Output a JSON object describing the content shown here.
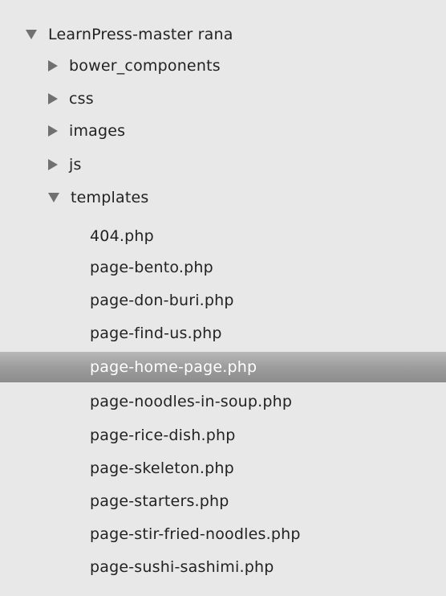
{
  "tree": {
    "root": {
      "label": "LearnPress-master rana",
      "expanded": true,
      "arrow_icon": "triangle-down-icon"
    },
    "folders": [
      {
        "label": "bower_components",
        "expanded": false,
        "arrow_icon": "triangle-right-icon"
      },
      {
        "label": "css",
        "expanded": false,
        "arrow_icon": "triangle-right-icon"
      },
      {
        "label": "images",
        "expanded": false,
        "arrow_icon": "triangle-right-icon"
      },
      {
        "label": "js",
        "expanded": false,
        "arrow_icon": "triangle-right-icon"
      },
      {
        "label": "templates",
        "expanded": true,
        "arrow_icon": "triangle-down-icon"
      }
    ],
    "files": [
      {
        "label": "404.php"
      },
      {
        "label": "page-bento.php"
      },
      {
        "label": "page-don-buri.php"
      },
      {
        "label": "page-find-us.php"
      },
      {
        "label": "page-home-page.php",
        "selected": true
      },
      {
        "label": "page-noodles-in-soup.php"
      },
      {
        "label": "page-rice-dish.php"
      },
      {
        "label": "page-skeleton.php"
      },
      {
        "label": "page-starters.php"
      },
      {
        "label": "page-stir-fried-noodles.php"
      },
      {
        "label": "page-sushi-sashimi.php"
      }
    ]
  },
  "colors": {
    "background": "#e8e8e8",
    "selection": "#9d9d9d",
    "selected_text": "#ffffff",
    "text": "#222222",
    "arrow": "#707070"
  }
}
